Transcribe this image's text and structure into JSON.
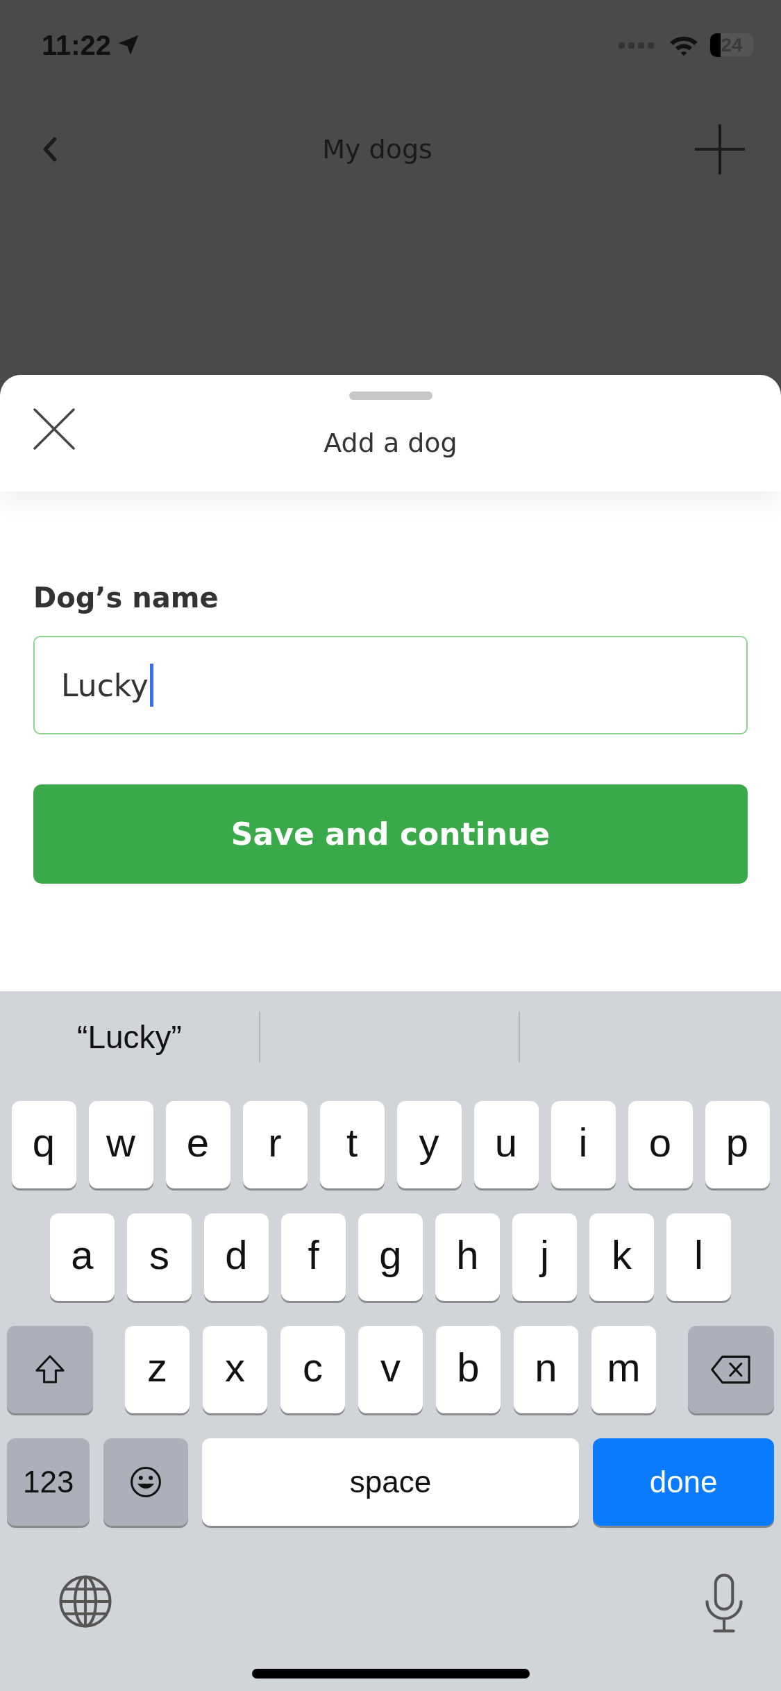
{
  "status_bar": {
    "time": "11:22",
    "battery": "24"
  },
  "nav_bar": {
    "title": "My dogs"
  },
  "sheet": {
    "title": "Add a dog",
    "field": {
      "label": "Dog’s name",
      "value": "Lucky",
      "focused": true
    },
    "button": "Save and continue"
  },
  "keyboard": {
    "suggestion": "“Lucky”",
    "rows": [
      [
        "q",
        "w",
        "e",
        "r",
        "t",
        "y",
        "u",
        "i",
        "o",
        "p"
      ],
      [
        "a",
        "s",
        "d",
        "f",
        "g",
        "h",
        "j",
        "k",
        "l"
      ],
      [
        "z",
        "x",
        "c",
        "v",
        "b",
        "n",
        "m"
      ]
    ],
    "mode_key": "123",
    "space_key": "space",
    "return_key": "done"
  }
}
